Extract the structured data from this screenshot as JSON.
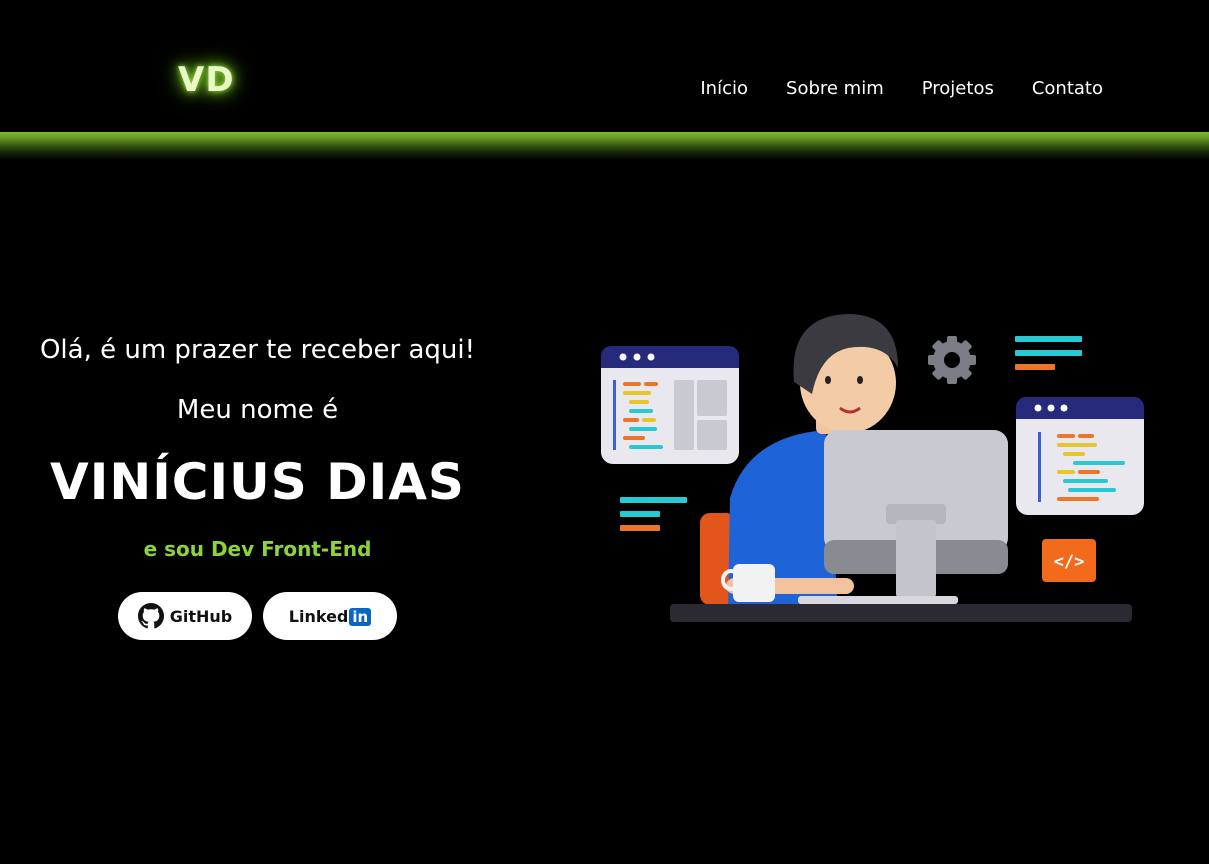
{
  "header": {
    "logo": "VD",
    "nav": [
      {
        "label": "Início"
      },
      {
        "label": "Sobre mim"
      },
      {
        "label": "Projetos"
      },
      {
        "label": "Contato"
      }
    ]
  },
  "hero": {
    "greeting": "Olá, é um prazer te receber aqui!",
    "intro": "Meu nome é",
    "name": "VINÍCIUS DIAS",
    "role": "e sou Dev Front-End",
    "social": {
      "github_label": "GitHub",
      "linkedin_label_prefix": "Linked",
      "linkedin_label_box": "in"
    },
    "code_icon_label": "</>"
  },
  "colors": {
    "background": "#000000",
    "accent_green": "#8ed33c",
    "logo_glow": "#9be33a",
    "linkedin_blue": "#0a66c2"
  },
  "icons": [
    "github-icon",
    "gear-icon",
    "code-window-icon",
    "code-tag-icon"
  ]
}
